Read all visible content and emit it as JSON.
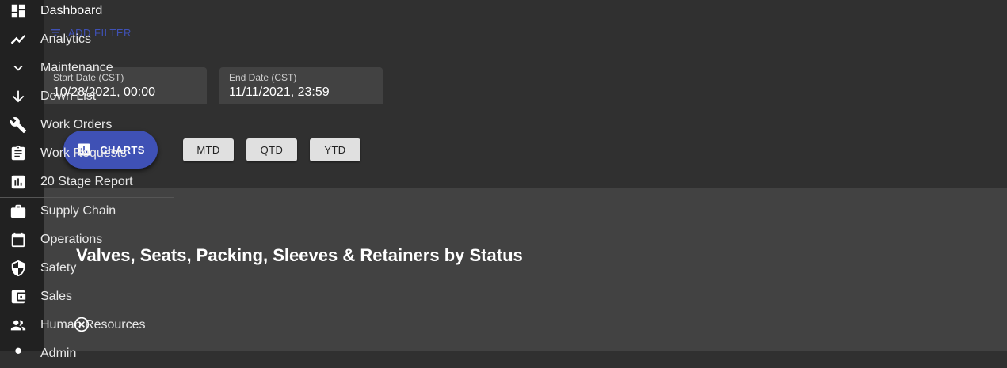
{
  "sidebar": {
    "items": [
      {
        "label": "Dashboard",
        "icon": "dashboard-icon"
      },
      {
        "label": "Analytics",
        "icon": "trending-icon"
      },
      {
        "label": "Maintenance",
        "icon": "chevron-down-icon"
      },
      {
        "label": "Down List",
        "icon": "arrow-down-icon"
      },
      {
        "label": "Work Orders",
        "icon": "wrench-icon"
      },
      {
        "label": "Work Requests",
        "icon": "clipboard-icon"
      },
      {
        "label": "20 Stage Report",
        "icon": "bar-chart-icon"
      },
      {
        "label": "Supply Chain",
        "icon": "briefcase-icon"
      },
      {
        "label": "Operations",
        "icon": "calendar-icon"
      },
      {
        "label": "Safety",
        "icon": "shield-icon"
      },
      {
        "label": "Sales",
        "icon": "wallet-icon"
      },
      {
        "label": "Human Resources",
        "icon": "people-icon"
      },
      {
        "label": "Admin",
        "icon": "admin-icon"
      }
    ]
  },
  "filter": {
    "add_filter_label": "ADD FILTER"
  },
  "dates": {
    "start_label": "Start Date (CST)",
    "start_value": "10/28/2021, 00:00",
    "end_label": "End Date (CST)",
    "end_value": "11/11/2021, 23:59"
  },
  "periods": {
    "mtd": "MTD",
    "qtd": "QTD",
    "ytd": "YTD"
  },
  "charts_button": "CHARTS",
  "chart_title": "Valves, Seats, Packing, Sleeves & Retainers by Status",
  "colors": {
    "accent": "#3f51b5",
    "sidebar": "#212121",
    "panel": "#424242"
  }
}
